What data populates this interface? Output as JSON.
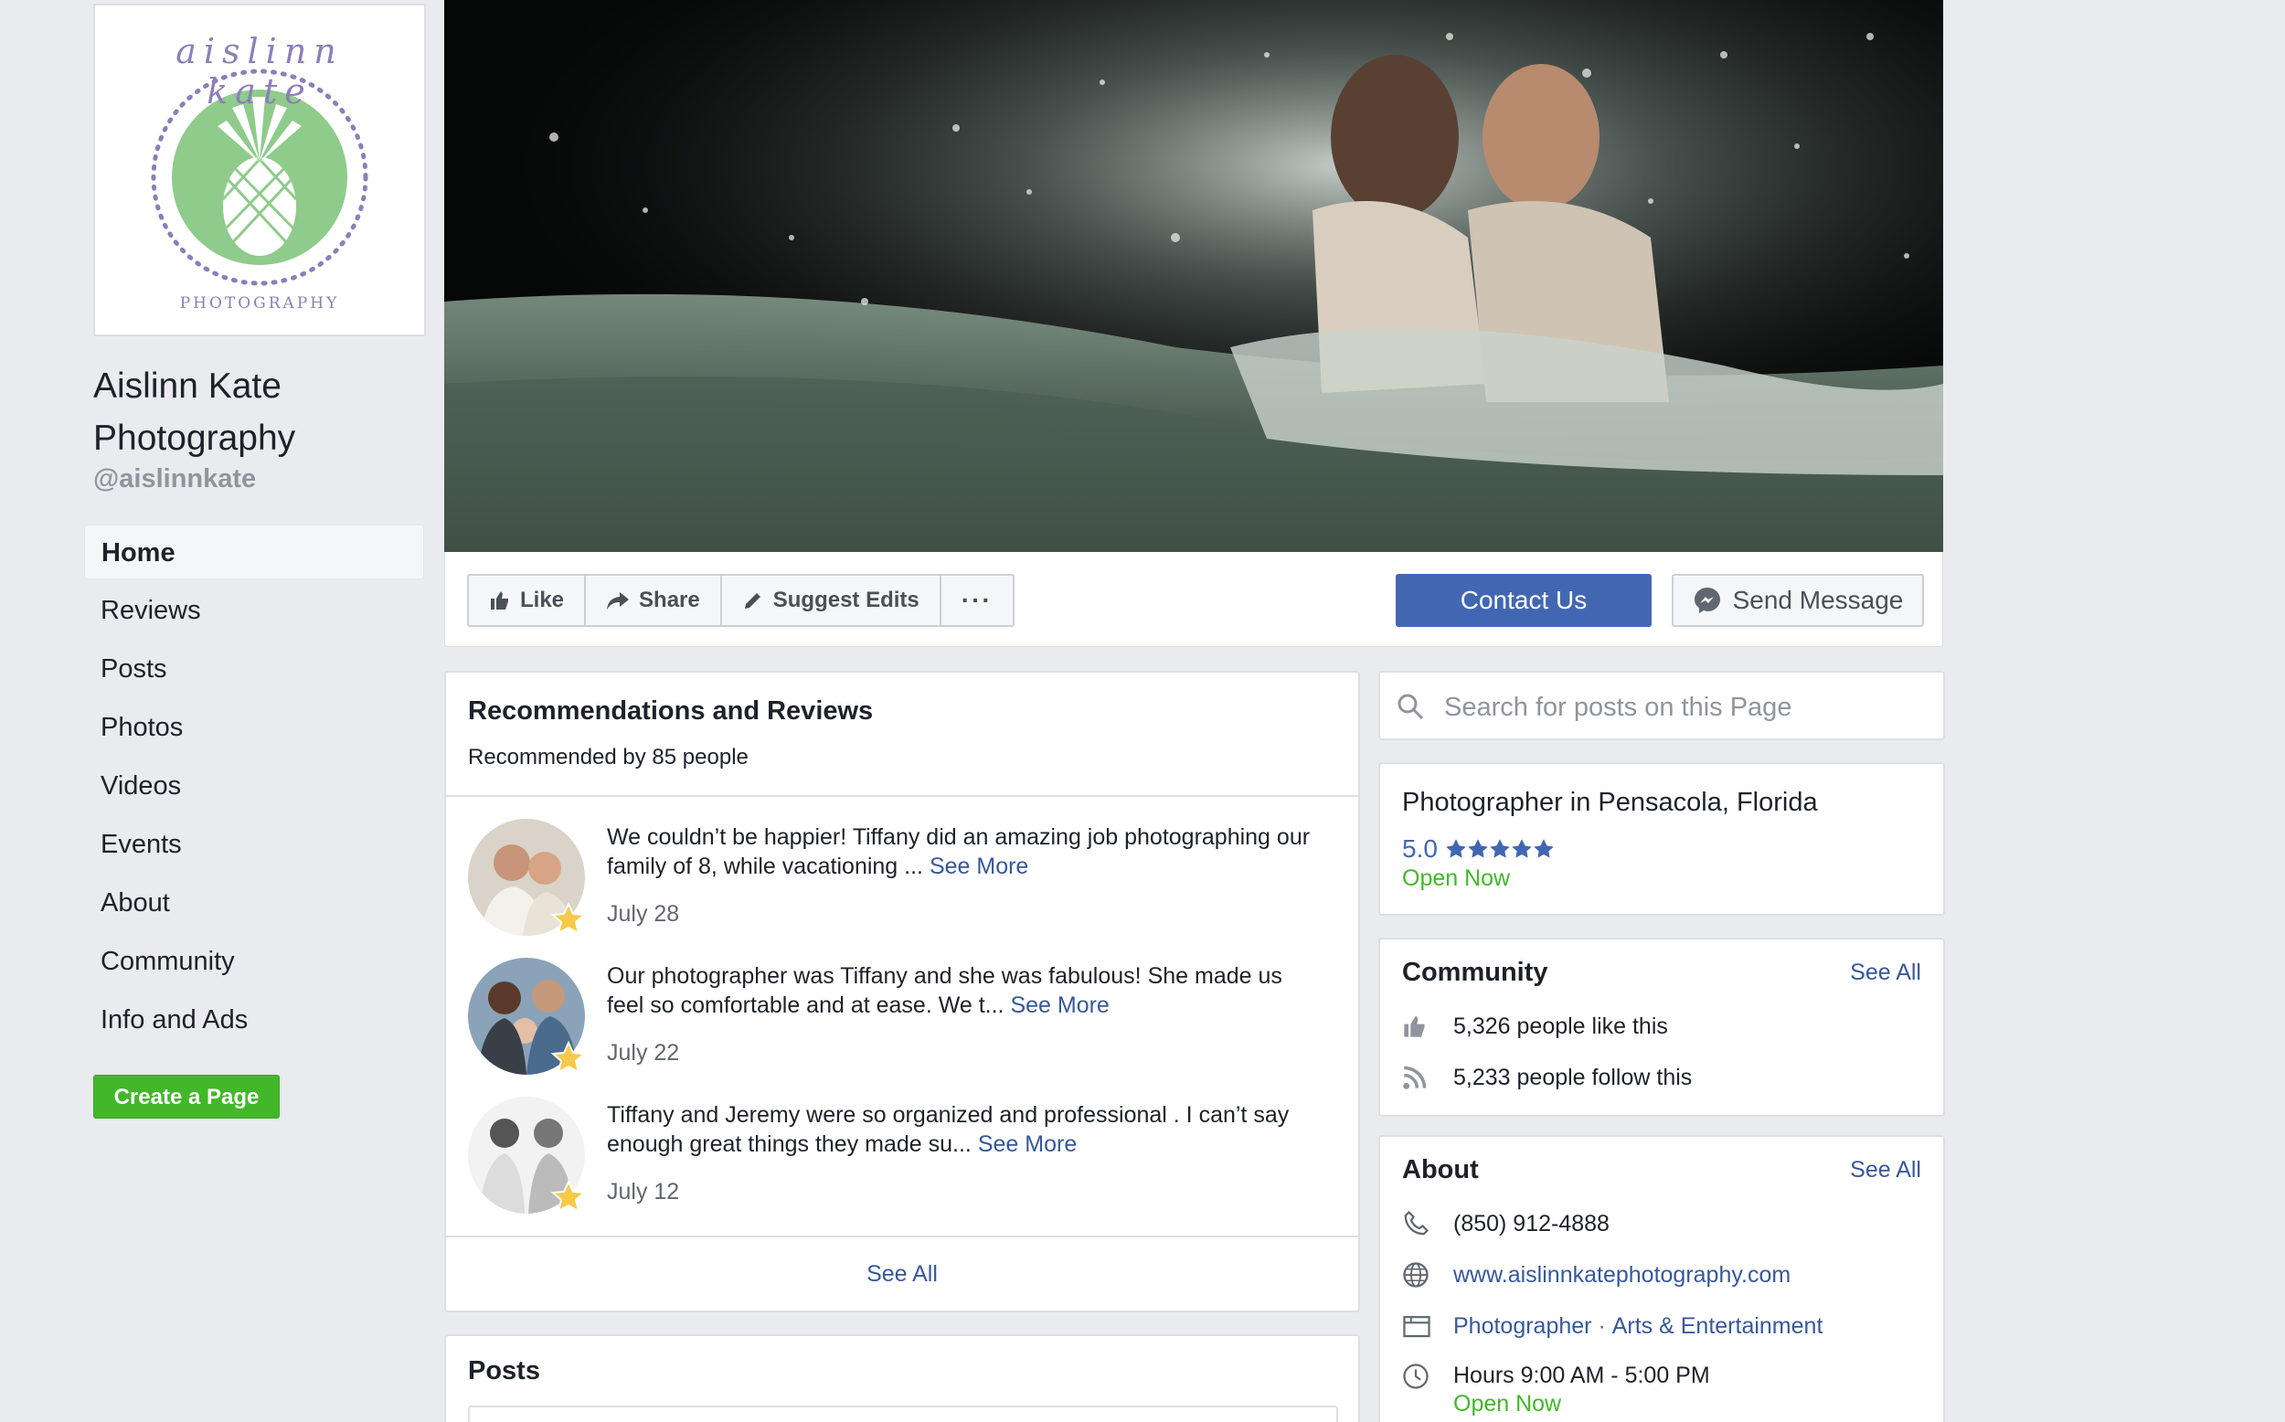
{
  "sidebar": {
    "logo": {
      "script_text": "aislinn kate",
      "sub_text": "PHOTOGRAPHY",
      "colors": {
        "ring": "#8b7fb8",
        "pineapple_bg": "#8fcb8b"
      }
    },
    "page_name": "Aislinn Kate Photography",
    "handle": "@aislinnkate",
    "nav": [
      {
        "label": "Home",
        "active": true
      },
      {
        "label": "Reviews"
      },
      {
        "label": "Posts"
      },
      {
        "label": "Photos"
      },
      {
        "label": "Videos"
      },
      {
        "label": "Events"
      },
      {
        "label": "About"
      },
      {
        "label": "Community"
      },
      {
        "label": "Info and Ads"
      }
    ],
    "create_page": "Create a Page"
  },
  "actions": {
    "like": "Like",
    "share": "Share",
    "suggest_edits": "Suggest Edits",
    "more": "···",
    "contact": "Contact Us",
    "send_message": "Send Message"
  },
  "recommendations": {
    "title": "Recommendations and Reviews",
    "subtitle": "Recommended by 85 people",
    "reviews": [
      {
        "text": "We couldn’t be happier! Tiffany did an amazing job photographing our family of 8, while vacationing ...",
        "see_more": "See More",
        "date": "July 28"
      },
      {
        "text": "Our photographer was Tiffany and she was fabulous! She made us feel so comfortable and at ease. We t...",
        "see_more": "See More",
        "date": "July 22"
      },
      {
        "text": "Tiffany and Jeremy were so organized and professional . I can’t say enough great things they made su...",
        "see_more": "See More",
        "date": "July 12"
      }
    ],
    "see_all": "See All"
  },
  "posts": {
    "title": "Posts"
  },
  "search": {
    "placeholder": "Search for posts on this Page"
  },
  "info": {
    "category_line": "Photographer in Pensacola, Florida",
    "rating": "5.0",
    "stars": 5,
    "open_status": "Open Now"
  },
  "community": {
    "title": "Community",
    "see_all": "See All",
    "likes": "5,326 people like this",
    "follows": "5,233 people follow this"
  },
  "about": {
    "title": "About",
    "see_all": "See All",
    "phone": "(850) 912-4888",
    "website": "www.aislinnkatephotography.com",
    "category_1": "Photographer",
    "separator": " · ",
    "category_2": "Arts & Entertainment",
    "hours": "Hours 9:00 AM - 5:00 PM",
    "open_status": "Open Now"
  },
  "colors": {
    "brand_blue": "#4267b2",
    "link_blue": "#365899",
    "green": "#42b72a",
    "star_gold": "#f7c948"
  }
}
